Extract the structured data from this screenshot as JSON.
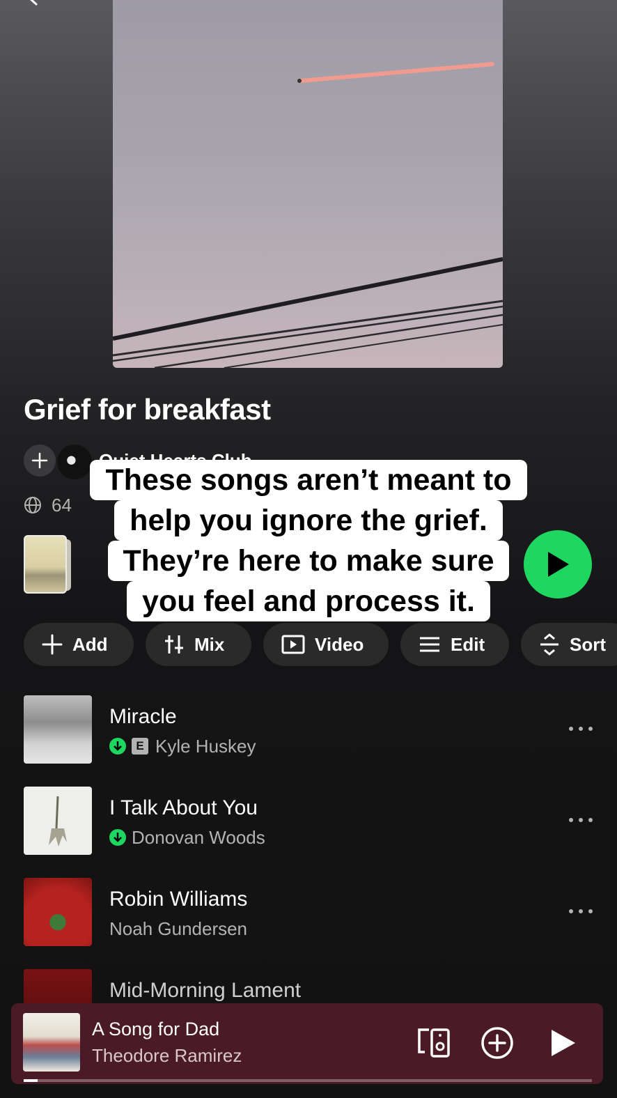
{
  "playlist": {
    "title": "Grief for breakfast",
    "owner": "Quiet Hearts Club",
    "meta": "64"
  },
  "overlay_caption": {
    "lines": [
      "These songs aren’t meant to",
      "help you ignore the grief.",
      "They’re here to make sure",
      "you feel and process it."
    ]
  },
  "actions": {
    "add": "Add",
    "mix": "Mix",
    "video": "Video",
    "edit": "Edit",
    "sort": "Sort"
  },
  "tracks": [
    {
      "title": "Miracle",
      "artist": "Kyle Huskey",
      "downloaded": true,
      "explicit": true,
      "explicit_label": "E"
    },
    {
      "title": "I Talk About You",
      "artist": "Donovan Woods",
      "downloaded": true,
      "explicit": false
    },
    {
      "title": "Robin Williams",
      "artist": "Noah Gundersen",
      "downloaded": false,
      "explicit": false
    },
    {
      "title": "Mid-Morning Lament",
      "artist": "",
      "downloaded": false,
      "explicit": false
    }
  ],
  "now_playing": {
    "title": "A Song for Dad",
    "artist": "Theodore Ramirez",
    "progress_fraction": 0.025
  },
  "colors": {
    "accent_green": "#1ed760",
    "mini_player_bg": "#4a1a26",
    "background": "#121212"
  },
  "icons": [
    "back-icon",
    "plus-icon",
    "globe-icon",
    "play-icon",
    "mix-icon",
    "video-icon",
    "edit-icon",
    "sort-icon",
    "download-icon",
    "more-icon",
    "devices-icon",
    "add-circle-icon"
  ]
}
